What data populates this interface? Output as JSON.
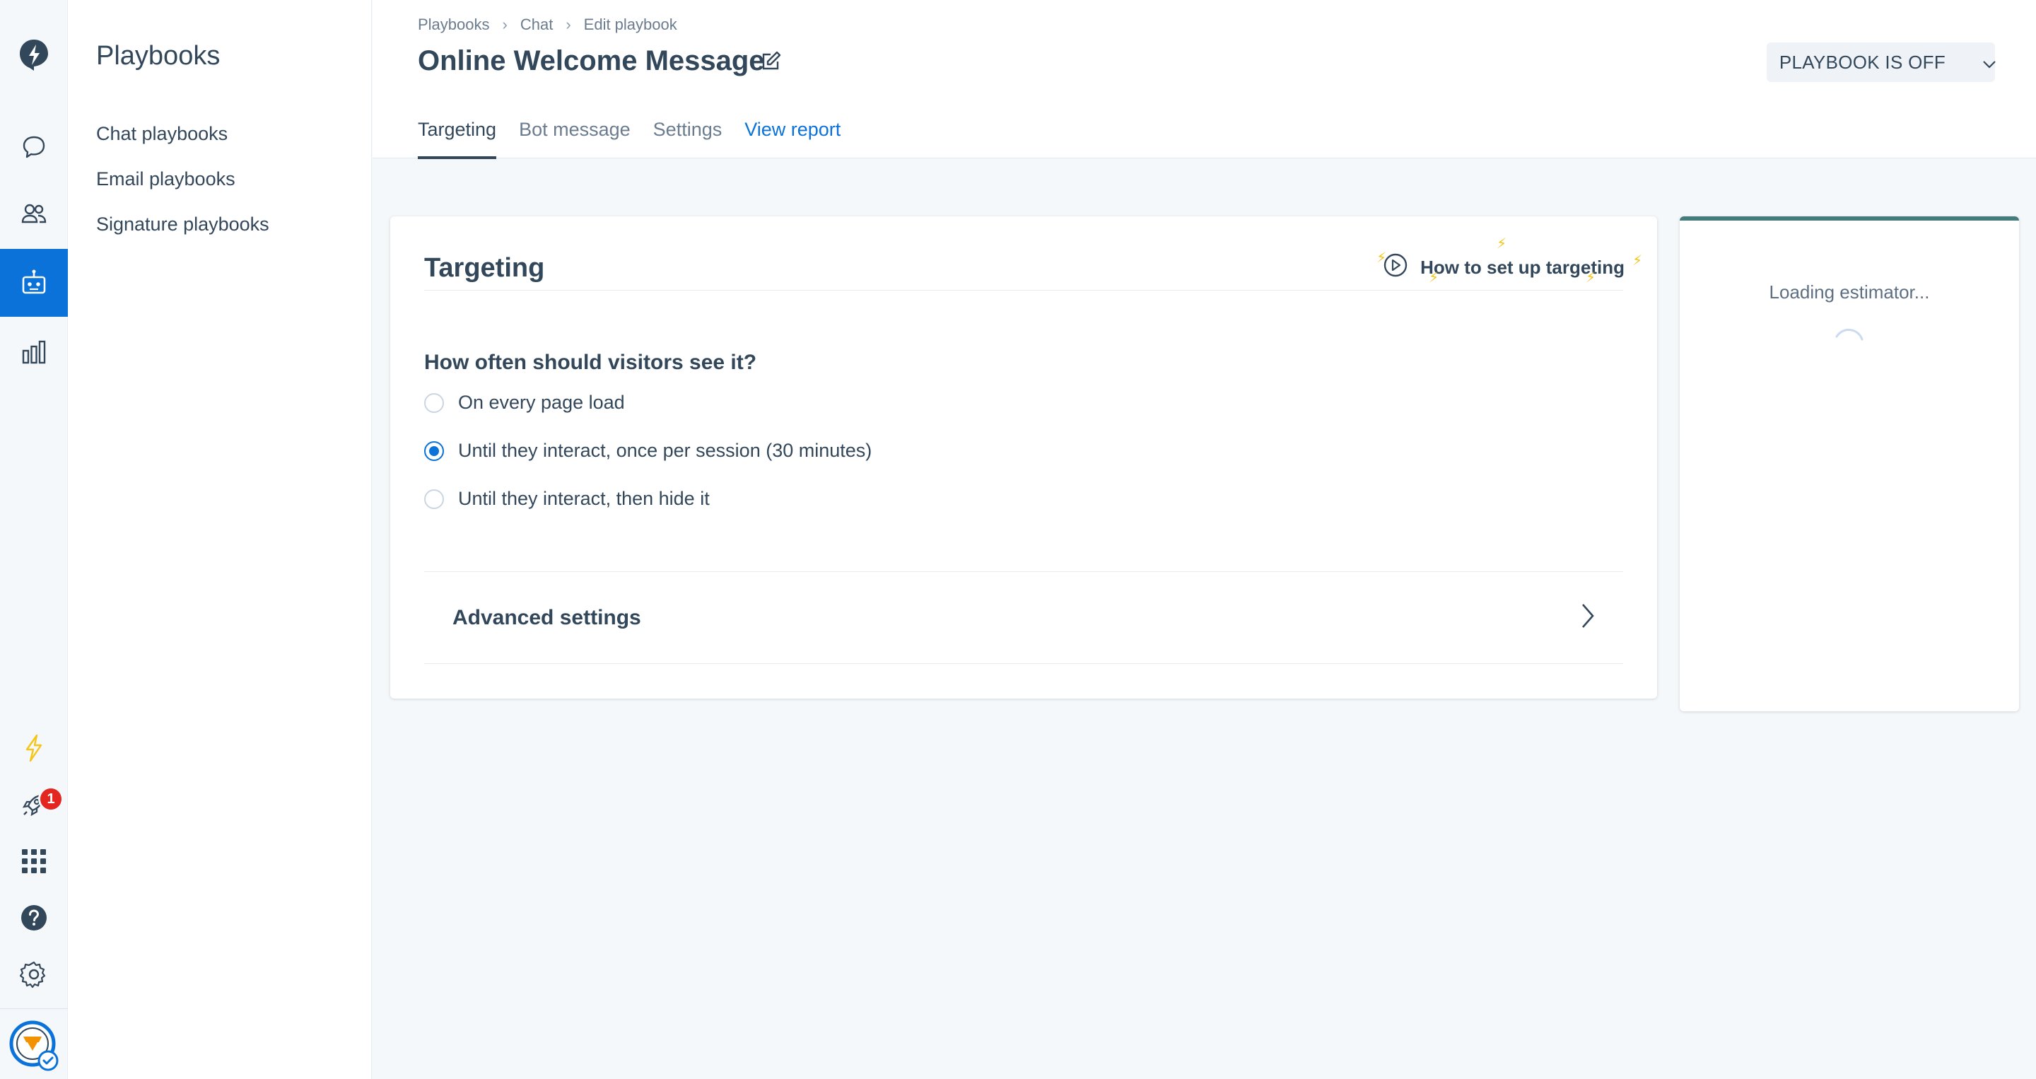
{
  "colors": {
    "accent": "#0b72d9",
    "text": "#33475b",
    "muted": "#6b7c8f",
    "badge": "#e3261f",
    "estimator_bar": "#447c7c"
  },
  "rail": {
    "items": [
      {
        "icon": "sprocket-logo-icon"
      },
      {
        "icon": "chat-bubble-icon"
      },
      {
        "icon": "contacts-icon"
      },
      {
        "icon": "bot-icon",
        "active": true
      },
      {
        "icon": "reports-icon"
      },
      {
        "icon": "lightning-icon"
      },
      {
        "icon": "rocket-icon",
        "badge": "1"
      },
      {
        "icon": "apps-grid-icon"
      },
      {
        "icon": "help-icon"
      },
      {
        "icon": "settings-icon"
      },
      {
        "icon": "account-avatar-icon"
      }
    ]
  },
  "subnav": {
    "title": "Playbooks",
    "items": [
      "Chat playbooks",
      "Email playbooks",
      "Signature playbooks"
    ]
  },
  "header": {
    "breadcrumb": [
      "Playbooks",
      "Chat",
      "Edit playbook"
    ],
    "title": "Online Welcome Message",
    "status_label": "PLAYBOOK IS OFF",
    "tabs": [
      {
        "label": "Targeting",
        "active": true
      },
      {
        "label": "Bot message"
      },
      {
        "label": "Settings"
      },
      {
        "label": "View report",
        "link": true
      }
    ]
  },
  "targeting": {
    "title": "Targeting",
    "howto_label": "How to set up targeting",
    "question": "How often should visitors see it?",
    "options": [
      {
        "label": "On every page load",
        "checked": false
      },
      {
        "label": "Until they interact, once per session (30 minutes)",
        "checked": true
      },
      {
        "label": "Until they interact, then hide it",
        "checked": false
      }
    ],
    "advanced_label": "Advanced settings"
  },
  "estimator": {
    "loading_text": "Loading estimator..."
  }
}
